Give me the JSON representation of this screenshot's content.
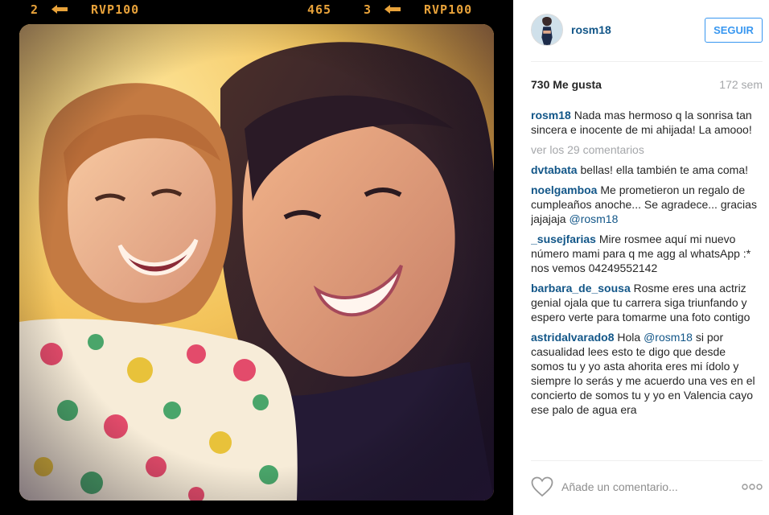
{
  "photo": {
    "film_labels": [
      "2",
      "RVP100",
      "465",
      "3",
      "RVP100"
    ]
  },
  "header": {
    "username": "rosm18",
    "follow_label": "SEGUIR"
  },
  "stats": {
    "likes": "730 Me gusta",
    "time": "172 sem"
  },
  "caption": {
    "user": "rosm18",
    "text": "Nada mas hermoso q la sonrisa tan sincera e inocente de mi ahijada! La amooo!"
  },
  "view_all": "ver los 29 comentarios",
  "comments": [
    {
      "user": "dvtabata",
      "text": "bellas! ella también te ama coma!",
      "mention": "",
      "after": ""
    },
    {
      "user": "noelgamboa",
      "text": "Me prometieron un regalo de cumpleaños anoche... Se agradece... gracias jajajaja ",
      "mention": "@rosm18",
      "after": ""
    },
    {
      "user": "_susejfarias",
      "text": "Mire rosmee aquí mi nuevo número mami para q me agg al whatsApp :* nos vemos 04249552142",
      "mention": "",
      "after": ""
    },
    {
      "user": "barbara_de_sousa",
      "text": "Rosme eres una actriz genial ojala que tu carrera siga triunfando y espero verte para tomarme una foto contigo",
      "mention": "",
      "after": ""
    },
    {
      "user": "astridalvarado8",
      "text": "Hola ",
      "mention": "@rosm18",
      "after": " si por casualidad lees esto te digo que desde somos tu y yo asta ahorita eres mi ídolo y siempre lo serás y me acuerdo una ves en el concierto de somos tu y yo en Valencia cayo ese palo de agua era"
    }
  ],
  "add_comment": {
    "placeholder": "Añade un comentario..."
  },
  "icons": {
    "like": "heart-icon",
    "more": "more-options-icon"
  },
  "colors": {
    "link": "#125688",
    "accent": "#3897f0",
    "muted": "#a5a7aa",
    "film_text": "#e8a23a"
  }
}
